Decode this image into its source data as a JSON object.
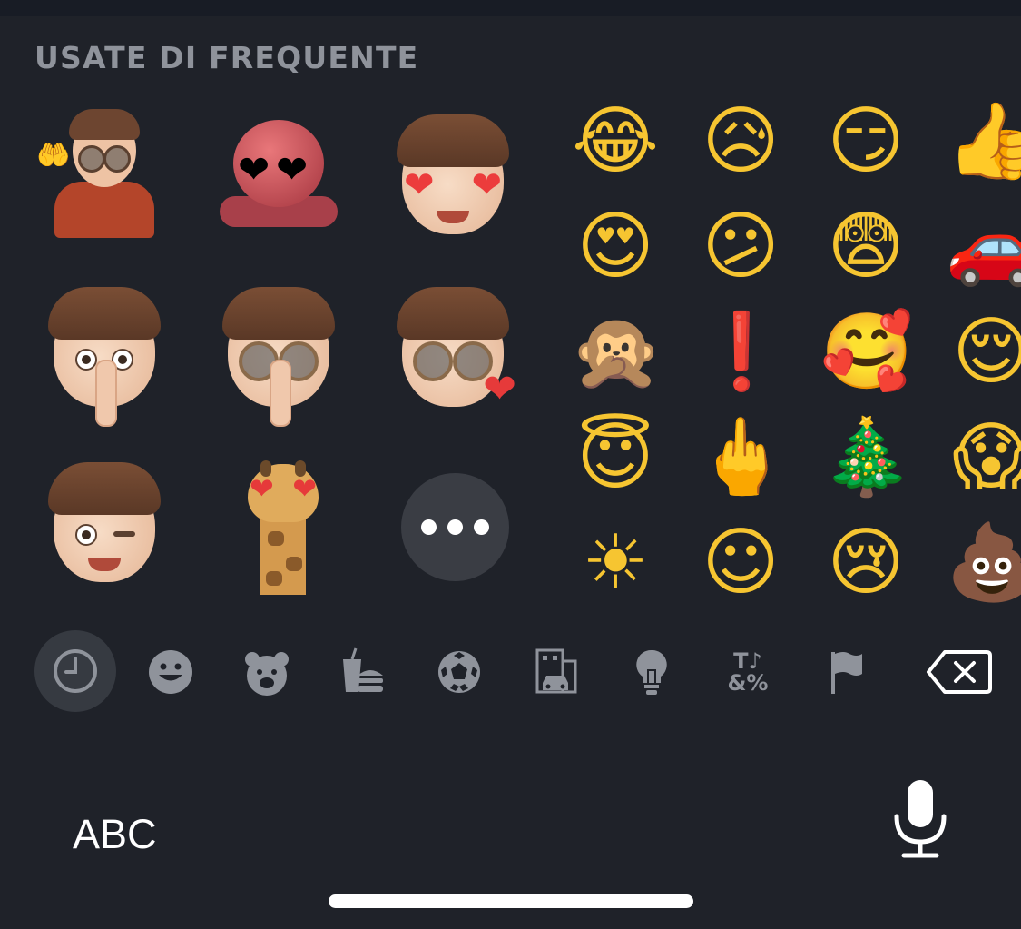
{
  "section": {
    "title": "USATE DI FREQUENTE"
  },
  "stickers": [
    {
      "name": "memoji-shrug"
    },
    {
      "name": "octopus-heart-eyes"
    },
    {
      "name": "memoji-heart-eyes"
    },
    {
      "name": "memoji-shush"
    },
    {
      "name": "memoji-shush-glasses"
    },
    {
      "name": "memoji-kiss-heart"
    },
    {
      "name": "memoji-wink"
    },
    {
      "name": "giraffe-heart-eyes"
    }
  ],
  "more_button": {
    "icon": "ellipsis-icon"
  },
  "emoji": {
    "row1": [
      "😂",
      "😥",
      "😏",
      "👍"
    ],
    "row2": [
      "😍",
      "😕",
      "😨",
      "🚗"
    ],
    "row3": [
      "🙊",
      "❗",
      "🥰",
      "😌"
    ],
    "row4": [
      "😇",
      "🖕",
      "🎄",
      "😱"
    ],
    "row5": [
      "☀",
      "☺",
      "😢",
      "💩"
    ]
  },
  "categories": [
    {
      "icon": "clock-icon",
      "selected": true
    },
    {
      "icon": "smiley-icon"
    },
    {
      "icon": "bear-icon"
    },
    {
      "icon": "food-icon"
    },
    {
      "icon": "soccer-ball-icon"
    },
    {
      "icon": "building-car-icon"
    },
    {
      "icon": "lightbulb-icon"
    },
    {
      "icon": "symbols-icon",
      "text": "T♪\n&%"
    },
    {
      "icon": "flag-icon"
    },
    {
      "icon": "backspace-icon"
    }
  ],
  "keyboard": {
    "abc_label": "ABC",
    "mic_icon": "microphone-icon"
  },
  "colors": {
    "background": "#1f2229",
    "icon_gray": "#8f939b",
    "selected_bg": "#363a41"
  }
}
